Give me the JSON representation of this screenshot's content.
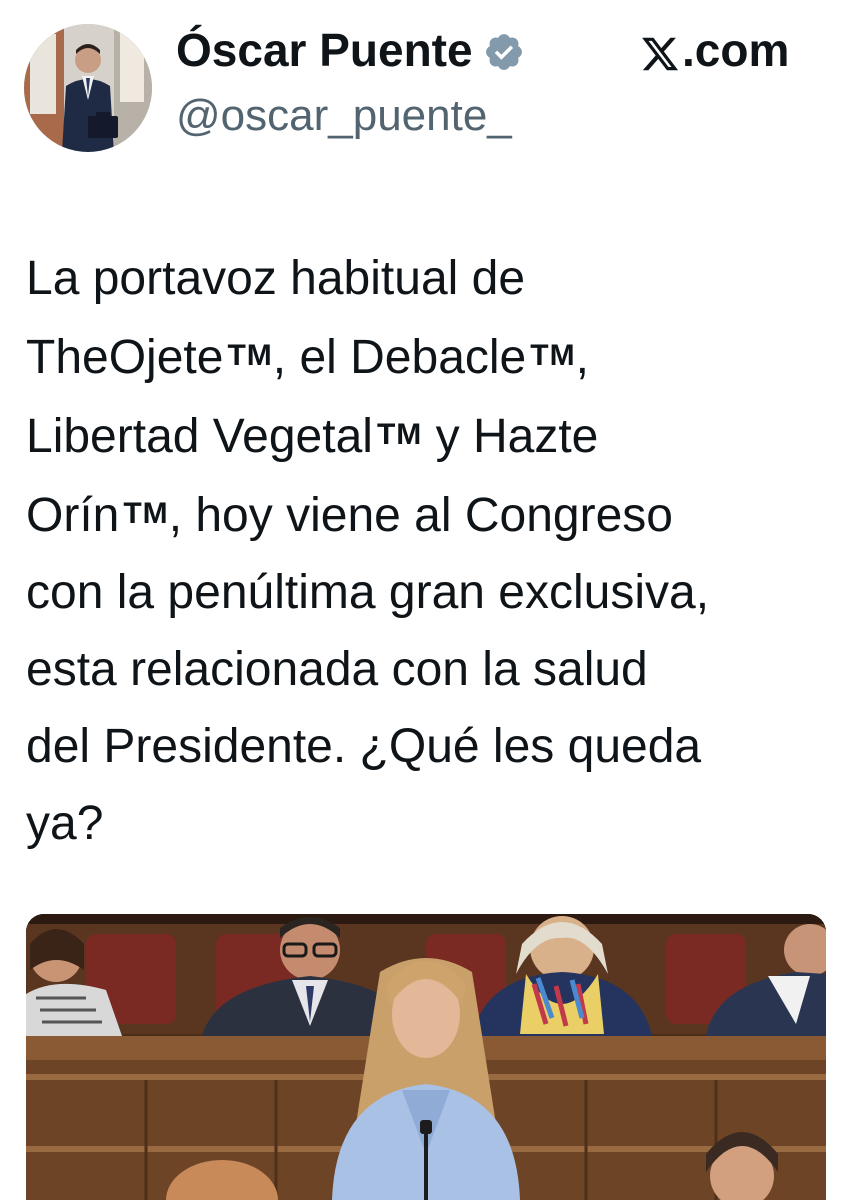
{
  "author": {
    "display_name": "Óscar Puente",
    "handle": "@oscar_puente_",
    "verified": true
  },
  "site": {
    "label": ".com",
    "logo_icon": "x-logo-icon"
  },
  "tweet": {
    "lines": [
      {
        "text": "La portavoz habitual de"
      },
      {
        "a": "TheOjete",
        "tm1": "TM",
        "b": ", el Debacle",
        "tm2": "TM",
        "c": ","
      },
      {
        "a": "Libertad Vegetal",
        "tm1": "TM",
        "b": " y Hazte"
      },
      {
        "a": "Orín",
        "tm1": "TM",
        "b": ", hoy viene al Congreso"
      },
      {
        "text": "con la penúltima gran exclusiva,"
      },
      {
        "text": "esta relacionada con la salud"
      },
      {
        "text": "del Presidente. ¿Qué les queda"
      },
      {
        "text": "ya?"
      }
    ]
  },
  "colors": {
    "text": "#0f1419",
    "secondary": "#536471",
    "verified_badge": "#829aab",
    "background": "#ffffff"
  }
}
